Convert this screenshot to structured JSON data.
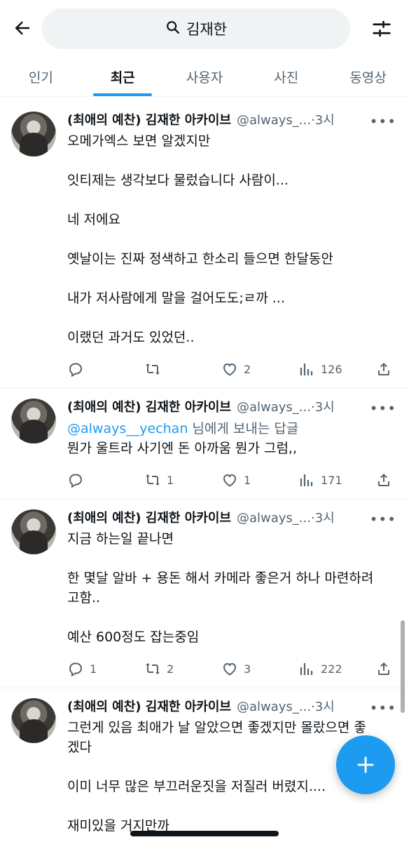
{
  "search": {
    "query": "김재한"
  },
  "tabs": [
    {
      "label": "인기"
    },
    {
      "label": "최근"
    },
    {
      "label": "사용자"
    },
    {
      "label": "사진"
    },
    {
      "label": "동영상"
    }
  ],
  "active_tab": "최근",
  "colors": {
    "accent": "#1d9bf0",
    "text": "#0f1419",
    "muted": "#536471"
  },
  "tweets": [
    {
      "name": "(최애의 예찬) 김재한 아카이브",
      "handle": "@always_...",
      "time": "·3시",
      "lines": [
        "오메가엑스 보면 알겠지만",
        "잇티제는 생각보다 물렀습니다 사람이...",
        "네 저에요",
        "옛날이는 진짜 정색하고 한소리 들으면 한달동안",
        "내가 저사람에게 말을 걸어도도;ㄹ까 ...",
        "이랬던 과거도 있었던.."
      ],
      "replies": "",
      "retweets": "",
      "likes": "2",
      "views": "126"
    },
    {
      "name": "(최애의 예찬) 김재한 아카이브",
      "handle": "@always_...",
      "time": "·3시",
      "reply_mention": "@always__yechan",
      "reply_suffix": " 님에게 보내는 답글",
      "lines": [
        "뭔가 울트라 사기엔 돈 아까움 뭔가 그럼,,"
      ],
      "replies": "",
      "retweets": "1",
      "likes": "1",
      "views": "171"
    },
    {
      "name": "(최애의 예찬) 김재한 아카이브",
      "handle": "@always_...",
      "time": "·3시",
      "lines": [
        "지금 하는일 끝나면",
        "한 몇달 알바 + 용돈 해서 카메라 좋은거 하나 마련하려",
        "고함..",
        "예산 600정도 잡는중임"
      ],
      "replies": "1",
      "retweets": "2",
      "likes": "3",
      "views": "222"
    },
    {
      "name": "(최애의 예찬) 김재한 아카이브",
      "handle": "@always_...",
      "time": "·3시",
      "lines": [
        "그런게 있음 최애가 날 알았으면 좋겠지만 몰랐으면 좋",
        "겠다",
        "이미 너무 많은 부끄러운짓을 저질러 버렸지....",
        "재미있을 거지만까"
      ]
    }
  ],
  "icons": [
    "back-arrow-icon",
    "search-icon",
    "filter-icon",
    "reply-icon",
    "retweet-icon",
    "like-icon",
    "views-icon",
    "share-icon",
    "more-icon",
    "compose-plus-icon"
  ]
}
